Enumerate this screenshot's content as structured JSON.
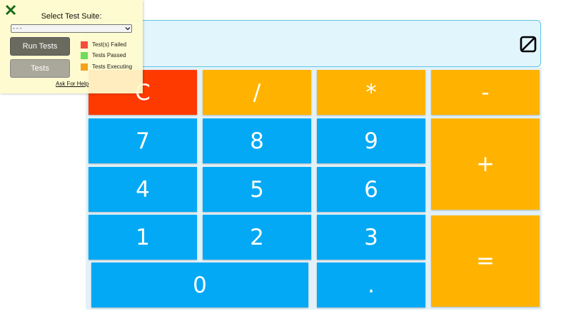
{
  "display": {
    "value": ""
  },
  "keys": {
    "clear": "C",
    "divide": "/",
    "multiply": "*",
    "subtract": "-",
    "add": "+",
    "equals": "=",
    "seven": "7",
    "eight": "8",
    "nine": "9",
    "four": "4",
    "five": "5",
    "six": "6",
    "one": "1",
    "two": "2",
    "three": "3",
    "zero": "0",
    "decimal": "."
  },
  "test_panel": {
    "title": "Select Test Suite:",
    "select_value": "- - -",
    "run_button": "Run Tests",
    "tests_button": "Tests",
    "legend": [
      {
        "label": "Test(s) Failed",
        "color": "#f44d3c"
      },
      {
        "label": "Tests Passed",
        "color": "#6fdc5a"
      },
      {
        "label": "Tests Executing",
        "color": "#f6a21c"
      }
    ],
    "help_link": "Ask For Help"
  },
  "colors": {
    "number_key": "#03a9f4",
    "operator_key": "#ffb300",
    "clear_key": "#ff3a00",
    "close_icon": "#1a6b1a"
  },
  "icons": {
    "close": "close-icon",
    "display_toggle": "toggle-icon",
    "select_arrow": "chevron-down-icon"
  }
}
